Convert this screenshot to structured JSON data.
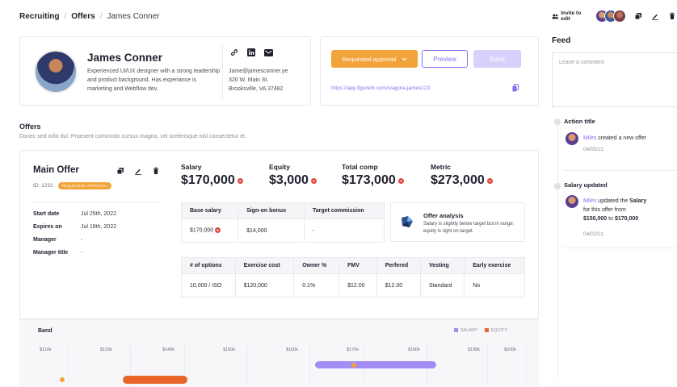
{
  "breadcrumb": {
    "level1": "Recruiting",
    "level2": "Offers",
    "current": "James Conner",
    "separator": "/"
  },
  "toolbar": {
    "invite_label": "Invite to edit"
  },
  "feed": {
    "title": "Feed",
    "comment_placeholder": "Leave a comment",
    "events": [
      {
        "title": "Action title",
        "actor": "Miles",
        "text": "created a new offer",
        "date": "04/05/21"
      },
      {
        "title": "Salary updated",
        "actor": "Miles",
        "text_before": "updated the",
        "field": "Salary",
        "text_mid": "for this offer from",
        "from": "$150,000",
        "to_word": "to",
        "to": "$170,000",
        "date": "04/02/21"
      }
    ]
  },
  "profile": {
    "name": "James Conner",
    "bio": "Experienced UI/UX designer with a strong leadership and product background. Has experiance is marketing and Webflow dev.",
    "email": "Jame@jamesconner.ye",
    "address_line1": "320 W. Main St.",
    "address_line2": "Brooksville, VA 37482"
  },
  "approval": {
    "status_label": "Requested approval",
    "preview_label": "Preview",
    "send_label": "Send",
    "link": "https://app.figurehr.com/o/agora-james123"
  },
  "offers": {
    "title": "Offers",
    "subtitle": "Donec sed odio dui. Praesent commodo cursus magna, vel scelerisque nisl consectetur et."
  },
  "main_offer": {
    "title": "Main Offer",
    "id_label": "ID: 1232",
    "badge": "REQUESTED APPROVAL",
    "details": [
      {
        "key": "Start date",
        "value": "Jul 25th, 2022"
      },
      {
        "key": "Expires on",
        "value": "Jul 18th, 2022"
      },
      {
        "key": "Manager",
        "value": "-"
      },
      {
        "key": "Manager title",
        "value": "-"
      }
    ],
    "metrics": [
      {
        "label": "Salary",
        "value": "$170,000"
      },
      {
        "label": "Equity",
        "value": "$3,000"
      },
      {
        "label": "Total comp",
        "value": "$173,000"
      },
      {
        "label": "Metric",
        "value": "$273,000"
      }
    ],
    "comp_table": {
      "headers": [
        "Base salary",
        "Sign-on bonus",
        "Target commission"
      ],
      "row": [
        "$170,000",
        "$14,000",
        "-"
      ]
    },
    "equity_table": {
      "headers": [
        "# of options",
        "Exercise cost",
        "Owner %",
        "FMV",
        "Perfered",
        "Vesting",
        "Early exercise"
      ],
      "row": [
        "10,000 / ISO",
        "$120,000",
        "0.1%",
        "$12.00",
        "$12.00",
        "Standard",
        "No"
      ]
    },
    "analysis": {
      "title": "Offer analysis",
      "body": "Salary is slightly below target but in range; equity is right on target."
    }
  },
  "band": {
    "title": "Band",
    "legend": [
      {
        "label": "SALARY",
        "color": "#a48cf5"
      },
      {
        "label": "EQUITY",
        "color": "#e8662a"
      }
    ],
    "ticks": [
      "$110k",
      "$130k",
      "$140k",
      "$150k",
      "$160k",
      "$170k",
      "$180k",
      "$190k",
      "$200k"
    ]
  },
  "colors": {
    "accent": "#8a6df2",
    "warning": "#f2a43a",
    "danger": "#e0473f",
    "equity": "#e8662a",
    "salary": "#a48cf5"
  }
}
